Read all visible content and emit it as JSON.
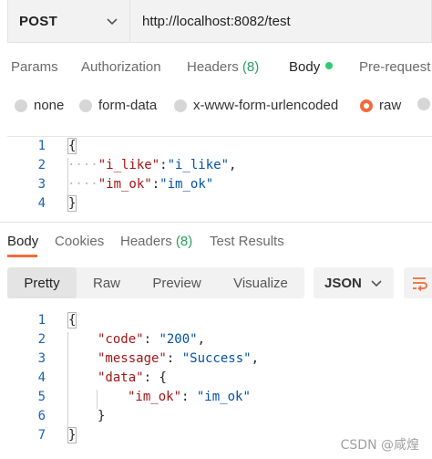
{
  "request": {
    "method": "POST",
    "url": "http://localhost:8082/test"
  },
  "request_tabs": [
    {
      "label": "Params"
    },
    {
      "label": "Authorization"
    },
    {
      "label": "Headers",
      "count": "(8)"
    },
    {
      "label": "Body",
      "active": true
    },
    {
      "label": "Pre-request"
    }
  ],
  "body_types": [
    {
      "label": "none"
    },
    {
      "label": "form-data"
    },
    {
      "label": "x-www-form-urlencoded"
    },
    {
      "label": "raw",
      "selected": true
    }
  ],
  "request_body": {
    "line_numbers": [
      "1",
      "2",
      "3",
      "4"
    ],
    "open_brace": "{",
    "close_brace": "}",
    "line2": {
      "ws": "····",
      "key": "\"i_like\"",
      "sep": ":",
      "value": "\"i_like\"",
      "comma": ","
    },
    "line3": {
      "ws": "····",
      "key": "\"im_ok\"",
      "sep": ":",
      "value": "\"im_ok\""
    }
  },
  "response_tabs": [
    {
      "label": "Body",
      "active": true
    },
    {
      "label": "Cookies"
    },
    {
      "label": "Headers",
      "count": "(8)"
    },
    {
      "label": "Test Results"
    }
  ],
  "view_modes": [
    {
      "label": "Pretty",
      "active": true
    },
    {
      "label": "Raw"
    },
    {
      "label": "Preview"
    },
    {
      "label": "Visualize"
    }
  ],
  "format_select": "JSON",
  "response_body": {
    "line_numbers": [
      "1",
      "2",
      "3",
      "4",
      "5",
      "6",
      "7"
    ],
    "open_brace": "{",
    "code_key": "\"code\"",
    "code_value": "\"200\"",
    "message_key": "\"message\"",
    "message_value": "\"Success\"",
    "data_key": "\"data\"",
    "data_open": "{",
    "im_ok_key": "\"im_ok\"",
    "im_ok_value": "\"im_ok\"",
    "data_close": "}",
    "close_brace": "}",
    "colon": ": ",
    "comma": ","
  },
  "watermark": "CSDN @咸煌",
  "colors": {
    "accent": "#f26b3a",
    "count_green": "#2c9e5f",
    "body_dot": "#2ecc71",
    "key_red": "#a31515",
    "string_blue": "#0451a5",
    "line_number_blue": "#1a63b8"
  },
  "icons": {
    "method_dropdown": "chevron-down-icon",
    "format_dropdown": "chevron-down-icon",
    "wrap": "wrap-lines-icon"
  }
}
